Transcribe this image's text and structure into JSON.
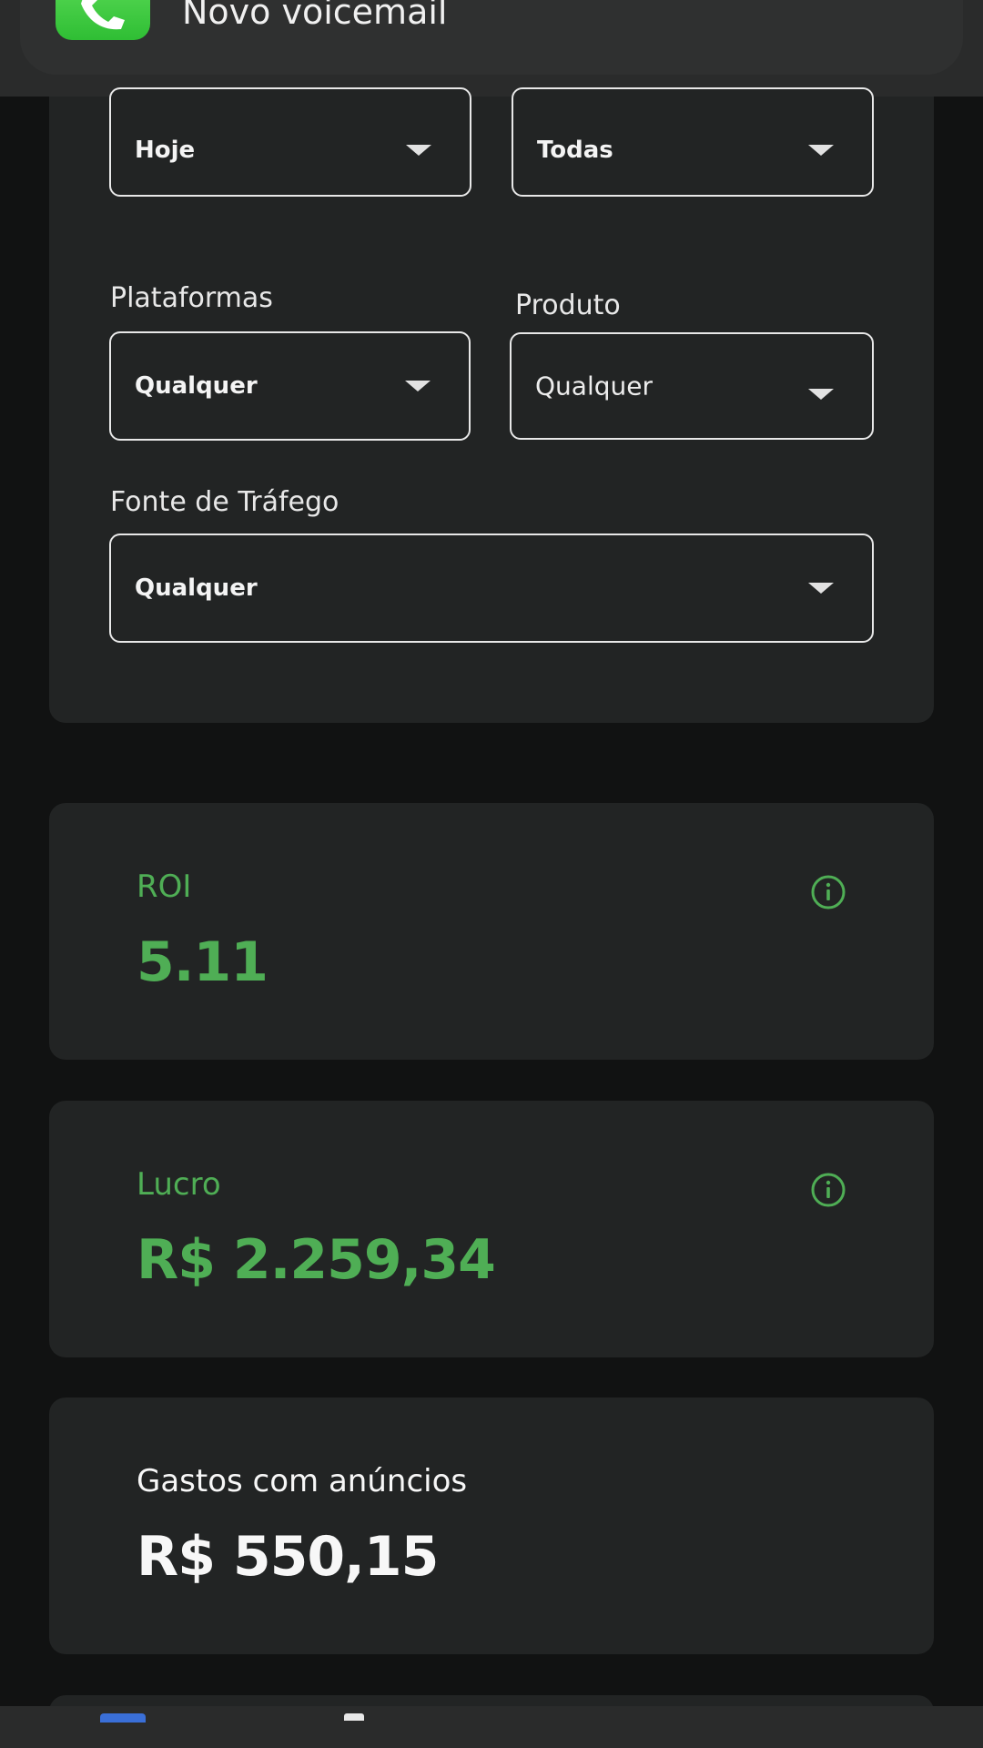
{
  "notification": {
    "app_icon": "phone-icon",
    "title": "Novo voicemail"
  },
  "filters": {
    "period": {
      "value": "Hoje"
    },
    "status": {
      "value": "Todas"
    },
    "platforms": {
      "label": "Plataformas",
      "value": "Qualquer"
    },
    "product": {
      "label": "Produto",
      "value": "Qualquer"
    },
    "traffic_source": {
      "label": "Fonte de Tráfego",
      "value": "Qualquer"
    }
  },
  "metrics": {
    "roi": {
      "label": "ROI",
      "value": "5.11",
      "icon": "info-icon"
    },
    "profit": {
      "label": "Lucro",
      "value": "R$ 2.259,34",
      "icon": "info-icon"
    },
    "ad_spend": {
      "label": "Gastos com anúncios",
      "value": "R$ 550,15"
    }
  },
  "colors": {
    "accent_green": "#4fae55",
    "card_bg": "#222424",
    "page_bg": "#111212"
  }
}
